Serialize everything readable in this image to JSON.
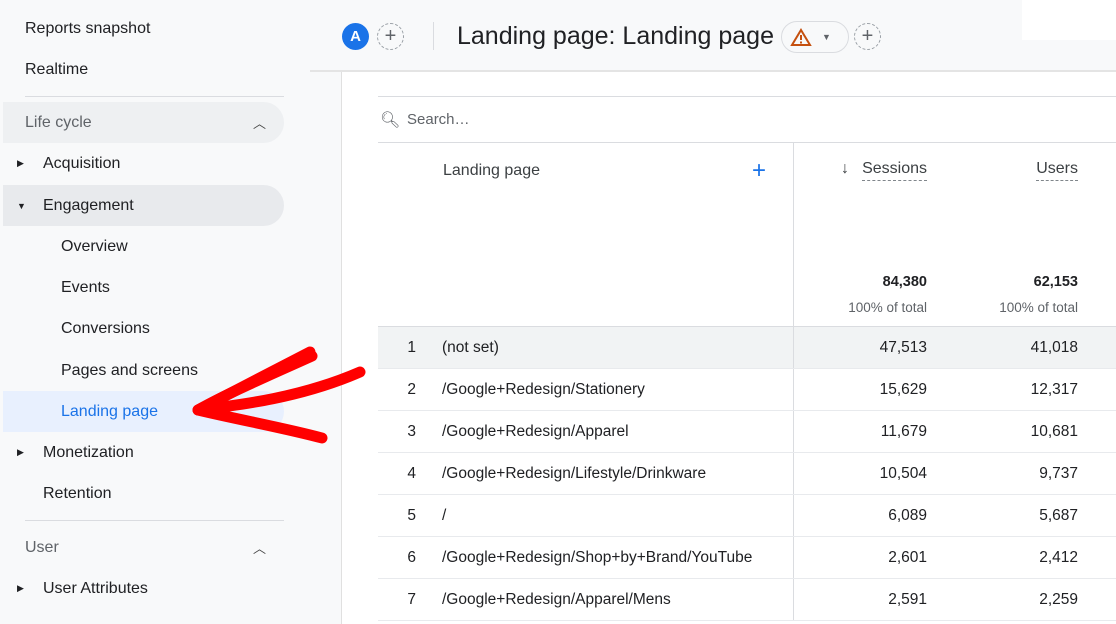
{
  "sidebar": {
    "top_items": [
      "Reports snapshot",
      "Realtime"
    ],
    "lifecycle": {
      "label": "Life cycle",
      "items": {
        "acquisition": "Acquisition",
        "engagement": "Engagement",
        "overview": "Overview",
        "events": "Events",
        "conversions": "Conversions",
        "pages": "Pages and screens",
        "landing": "Landing page",
        "monetization": "Monetization",
        "retention": "Retention"
      }
    },
    "user": {
      "label": "User",
      "items": {
        "attributes": "User Attributes"
      }
    }
  },
  "header": {
    "avatar": "A",
    "title": "Landing page: Landing page",
    "accent": "#1a73e8",
    "warning_color": "#c5500f"
  },
  "table": {
    "search_placeholder": "Search…",
    "columns": {
      "dimension": "Landing page",
      "sessions": "Sessions",
      "users": "Users"
    },
    "totals": {
      "sessions": "84,380",
      "sessions_pct": "100% of total",
      "users": "62,153",
      "users_pct": "100% of total"
    },
    "rows": [
      {
        "idx": "1",
        "page": "(not set)",
        "sessions": "47,513",
        "users": "41,018"
      },
      {
        "idx": "2",
        "page": "/Google+Redesign/Stationery",
        "sessions": "15,629",
        "users": "12,317"
      },
      {
        "idx": "3",
        "page": "/Google+Redesign/Apparel",
        "sessions": "11,679",
        "users": "10,681"
      },
      {
        "idx": "4",
        "page": "/Google+Redesign/Lifestyle/Drinkware",
        "sessions": "10,504",
        "users": "9,737"
      },
      {
        "idx": "5",
        "page": "/",
        "sessions": "6,089",
        "users": "5,687"
      },
      {
        "idx": "6",
        "page": "/Google+Redesign/Shop+by+Brand/YouTube",
        "sessions": "2,601",
        "users": "2,412"
      },
      {
        "idx": "7",
        "page": "/Google+Redesign/Apparel/Mens",
        "sessions": "2,591",
        "users": "2,259"
      }
    ]
  }
}
